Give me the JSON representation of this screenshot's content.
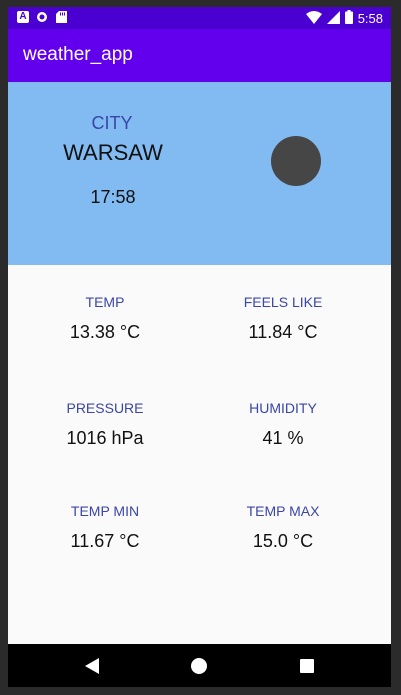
{
  "status_bar": {
    "time": "5:58",
    "icons": [
      "a-notification-icon",
      "circle-notification-icon",
      "sd-card-icon",
      "wifi-icon",
      "signal-icon",
      "battery-icon"
    ]
  },
  "app_bar": {
    "title": "weather_app",
    "color": "#6200ee"
  },
  "header": {
    "city_label": "CITY",
    "city_name": "WARSAW",
    "time": "17:58",
    "background": "#82baf2"
  },
  "details": {
    "temp": {
      "label": "TEMP",
      "value": "13.38 °C"
    },
    "feels_like": {
      "label": "FEELS LIKE",
      "value": "11.84 °C"
    },
    "pressure": {
      "label": "PRESSURE",
      "value": "1016 hPa"
    },
    "humidity": {
      "label": "HUMIDITY",
      "value": "41 %"
    },
    "temp_min": {
      "label": "TEMP MIN",
      "value": "11.67 °C"
    },
    "temp_max": {
      "label": "TEMP MAX",
      "value": "15.0 °C"
    }
  },
  "nav_bar": {
    "buttons": [
      "back-icon",
      "home-icon",
      "recents-icon"
    ]
  }
}
